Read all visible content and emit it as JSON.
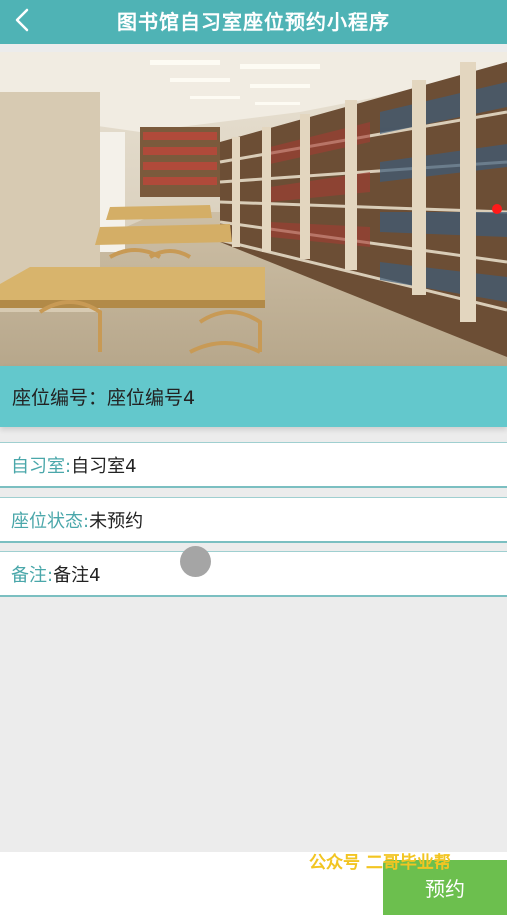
{
  "header": {
    "title": "图书馆自习室座位预约小程序",
    "back_icon": "chevron-left-icon",
    "background": "#4fb3b5"
  },
  "seat": {
    "number_label": "座位编号：",
    "number_value": "座位编号4"
  },
  "details": {
    "room_label": "自习室:",
    "room_value": "自习室4",
    "status_label": "座位状态:",
    "status_value": "未预约",
    "note_label": "备注:",
    "note_value": "备注4"
  },
  "footer": {
    "watermark": "公众号 二哥毕业帮",
    "reserve_label": "预约",
    "reserve_color": "#6cbf4e"
  },
  "colors": {
    "accent": "#63c8cc",
    "label": "#4aa7aa"
  }
}
